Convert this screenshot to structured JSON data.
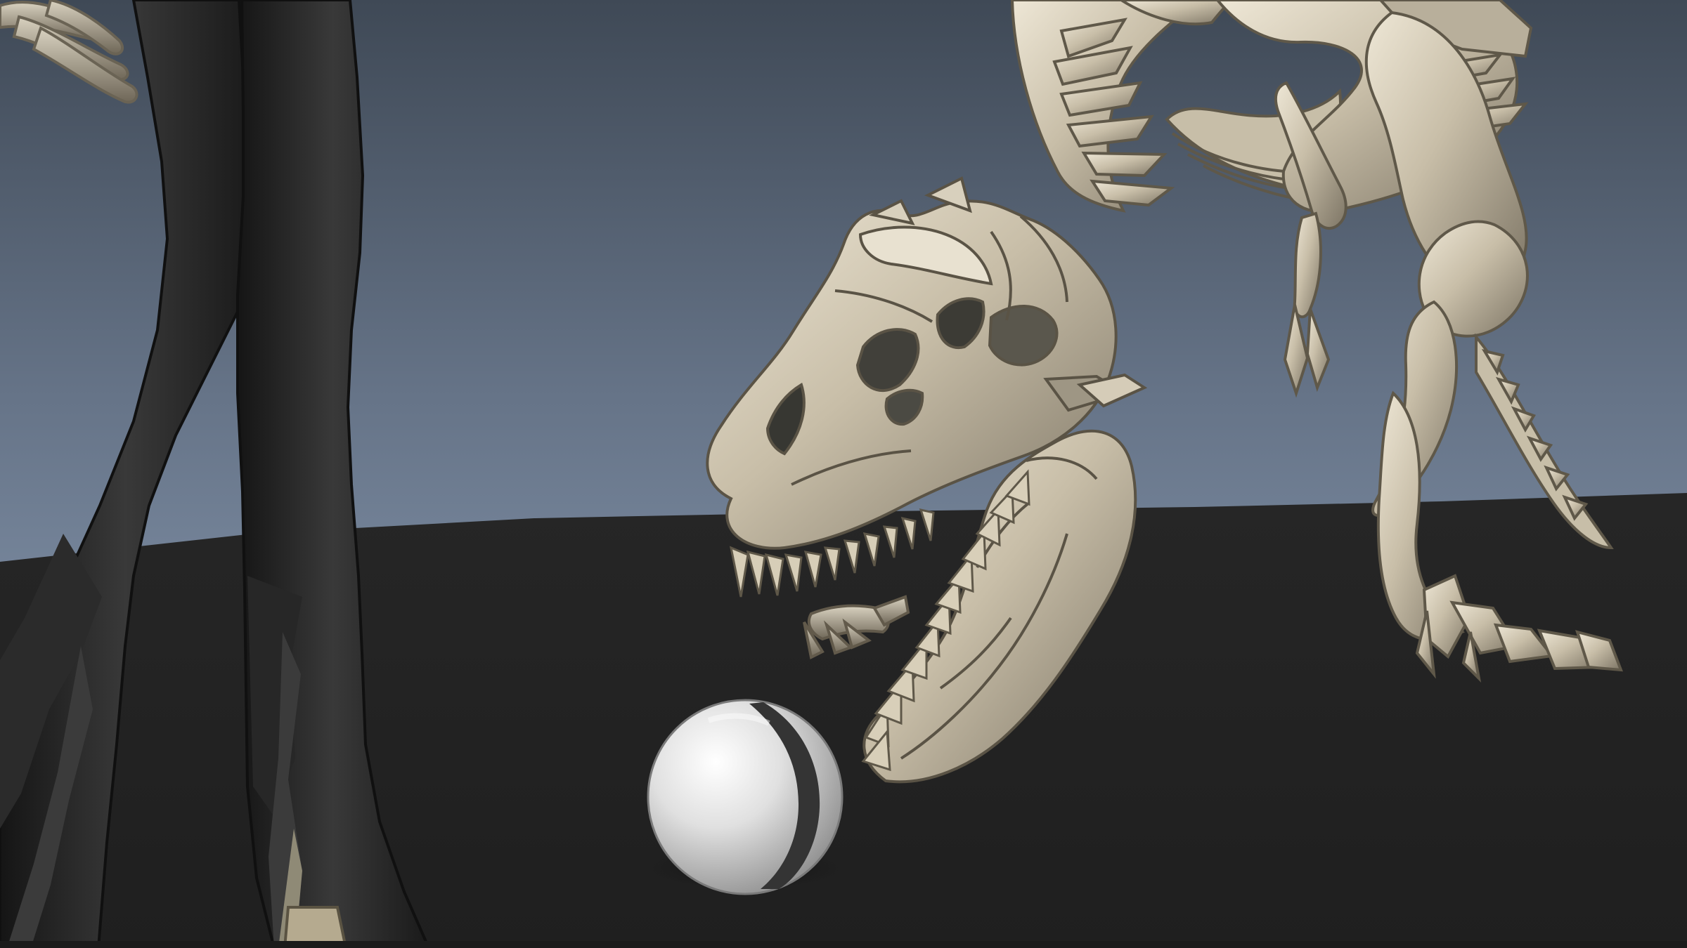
{
  "viewport": {
    "colors": {
      "sky_top": "#3f4956",
      "sky_bottom": "#93a5bd",
      "ground": "#232323",
      "bone_light": "#e3ddcc",
      "bone_mid": "#b9b09b",
      "bone_dark": "#6f6758",
      "legs_dark": "#1f1f1f",
      "legs_mid": "#343434",
      "ball_light": "#f2f2f2",
      "ball_shadow": "#9c9c9c",
      "ball_stripe": "#333333"
    },
    "objects": [
      "character-legs",
      "skeleton-hand",
      "trex-skeleton",
      "trex-skull",
      "trex-jaw",
      "trex-arm",
      "trex-leg",
      "striped-ball",
      "ground-plane"
    ]
  }
}
